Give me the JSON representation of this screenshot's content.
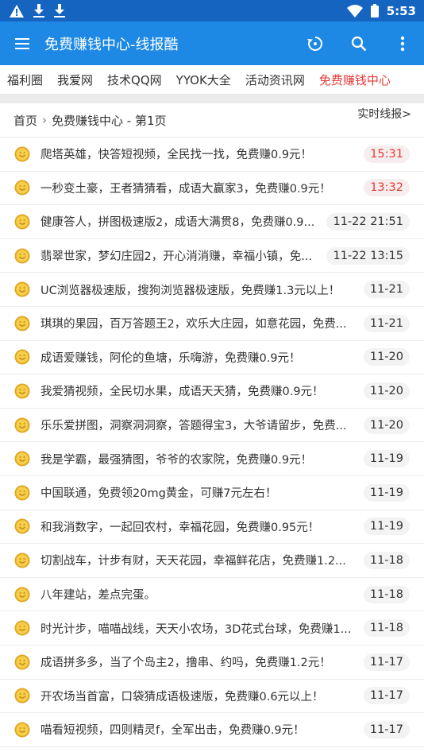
{
  "status": {
    "time": "5:53"
  },
  "appbar": {
    "title": "免费赚钱中心-线报酷"
  },
  "tabs": [
    {
      "label": "福利圈"
    },
    {
      "label": "我爱网"
    },
    {
      "label": "技术QQ网"
    },
    {
      "label": "YYOK大全"
    },
    {
      "label": "活动资讯网"
    },
    {
      "label": "免费赚钱中心",
      "active": true
    }
  ],
  "breadcrumb": {
    "home": "首页",
    "separator": "›",
    "current": "免费赚钱中心 - 第1页",
    "realtime": "实时线报>"
  },
  "items": [
    {
      "text": "爬塔英雄，快答短视频，全民找一找，免费赚0.9元！",
      "time": "15:31",
      "hot": true
    },
    {
      "text": "一秒变土豪，王者猜猜看，成语大赢家3，免费赚0.9元！",
      "time": "13:32",
      "hot": true
    },
    {
      "text": "健康答人，拼图极速版2，成语大满贯8，免费赚0.9...",
      "time": "11-22 21:51",
      "hot": false
    },
    {
      "text": "翡翠世家，梦幻庄园2，开心消消赚，幸福小镇，免...",
      "time": "11-22 13:15",
      "hot": false
    },
    {
      "text": "UC浏览器极速版，搜狗浏览器极速版，免费赚1.3元以上！",
      "time": "11-21",
      "hot": false
    },
    {
      "text": "琪琪的果园，百万答题王2，欢乐大庄园，如意花园，免费...",
      "time": "11-21",
      "hot": false
    },
    {
      "text": "成语爱赚钱，阿伦的鱼塘，乐嗨游，免费赚0.9元！",
      "time": "11-20",
      "hot": false
    },
    {
      "text": "我爱猜视频，全民切水果，成语天天猜，免费赚0.9元！",
      "time": "11-20",
      "hot": false
    },
    {
      "text": "乐乐爱拼图，洞察洞洞察，答题得宝3，大爷请留步，免费...",
      "time": "11-20",
      "hot": false
    },
    {
      "text": "我是学霸，最强猜图，爷爷的农家院，免费赚0.9元！",
      "time": "11-19",
      "hot": false
    },
    {
      "text": "中国联通，免费领20mg黄金，可赚7元左右！",
      "time": "11-19",
      "hot": false
    },
    {
      "text": "和我消数字，一起回农村，幸福花园，免费赚0.95元！",
      "time": "11-19",
      "hot": false
    },
    {
      "text": "切割战车，计步有财，天天花园，幸福鲜花店，免费赚1.2...",
      "time": "11-18",
      "hot": false
    },
    {
      "text": "八年建站，差点完蛋。",
      "time": "11-18",
      "hot": false
    },
    {
      "text": "时光计步，喵喵战线，天天小农场，3D花式台球，免费赚1...",
      "time": "11-18",
      "hot": false
    },
    {
      "text": "成语拼多多，当了个岛主2，撸串、约吗，免费赚1.2元！",
      "time": "11-17",
      "hot": false
    },
    {
      "text": "开农场当首富，口袋猜成语极速版，免费赚0.6元以上！",
      "time": "11-17",
      "hot": false
    },
    {
      "text": "喵看短视频，四则精灵f，全军出击，免费赚0.9元！",
      "time": "11-17",
      "hot": false
    }
  ],
  "colors": {
    "statusbar": "#1565c0",
    "appbar": "#1e88e5",
    "active_tab": "#e53935",
    "hot_time": "#e53935",
    "coin": "#f2c23a"
  }
}
